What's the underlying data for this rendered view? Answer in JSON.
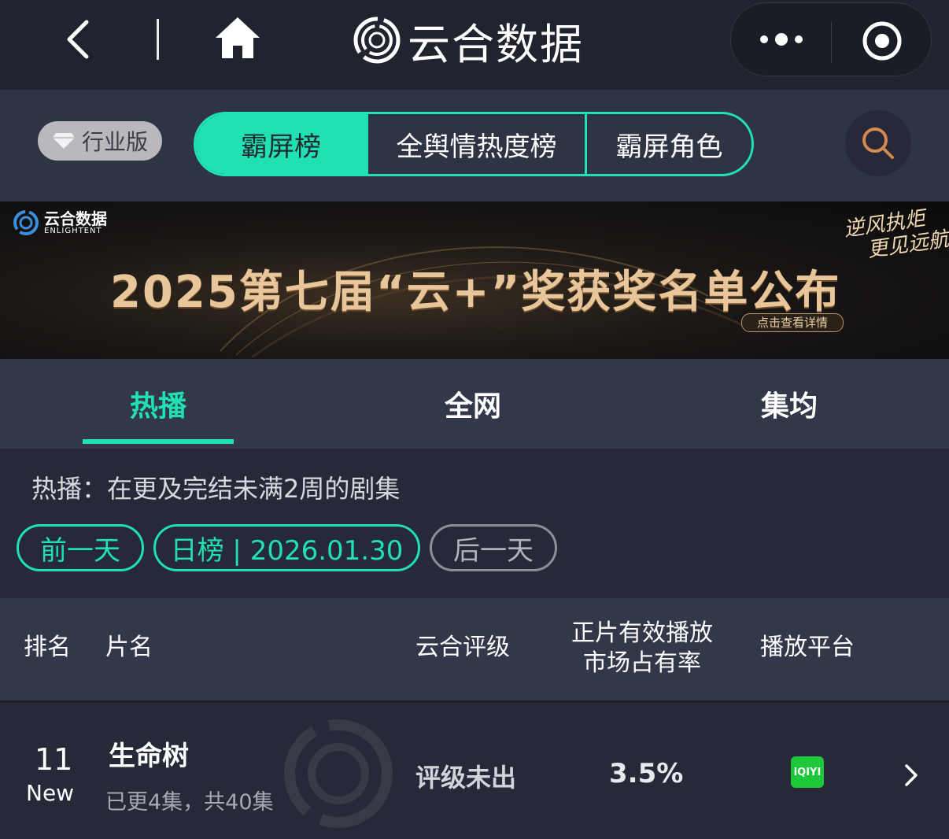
{
  "app": {
    "title": "云合数据"
  },
  "nav": {
    "edition": "行业版",
    "segments": [
      "霸屏榜",
      "全舆情热度榜",
      "霸屏角色"
    ],
    "active_segment": 0
  },
  "banner": {
    "logo_cn": "云合数据",
    "logo_en": "ENLIGHTENT",
    "title": "2025第七届“云+”奖获奖名单公布",
    "slogan_line1": "逆风执炬",
    "slogan_line2": "更见远航",
    "button": "点击查看详情"
  },
  "tabs": [
    "热播",
    "全网",
    "集均"
  ],
  "description": "热播：在更及完结未满2周的剧集",
  "date_nav": {
    "prev": "前一天",
    "current": "日榜 | 2026.01.30",
    "next": "后一天"
  },
  "table": {
    "headers": {
      "rank": "排名",
      "title": "片名",
      "rating": "云合评级",
      "share_line1": "正片有效播放",
      "share_line2": "市场占有率",
      "platform": "播放平台"
    },
    "rows": [
      {
        "rank": "11",
        "badge": "New",
        "title": "生命树",
        "episodes": "已更4集，共40集",
        "rating": "评级未出",
        "share": "3.5%",
        "platform": "iQIYI"
      }
    ]
  },
  "colors": {
    "accent": "#20e0b4",
    "background": "#262a38",
    "platform": "#1ec63a"
  },
  "icons": [
    "back-icon",
    "home-icon",
    "more-icon",
    "target-icon",
    "diamond-icon",
    "search-icon",
    "chevron-right-icon"
  ]
}
